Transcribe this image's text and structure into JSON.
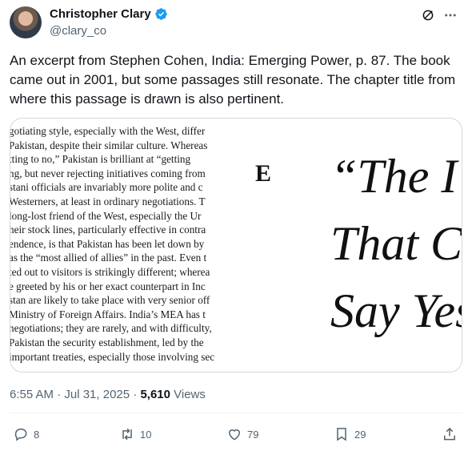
{
  "author": {
    "name": "Christopher Clary",
    "handle": "@clary_co"
  },
  "tweet": {
    "text": "An excerpt from Stephen Cohen, India: Emerging Power, p. 87. The book came out in 2001, but some passages still resonate. The chapter title from where this passage is drawn is also pertinent."
  },
  "image": {
    "left_lines": [
      "gotiating style, especially with the West, differ",
      "Pakistan, despite their similar culture. Whereas",
      "tting to no,” Pakistan is brilliant at “getting",
      "ng, but never rejecting initiatives coming from",
      "stani officials are invariably more polite and c",
      "Westerners, at least in ordinary negotiations. T",
      "long-lost friend of the West, especially the Ur",
      "heir stock lines, particularly effective in contra",
      "endence, is that Pakistan has been let down by",
      "as the “most allied of allies” in the past. Even t",
      "ted out to visitors is strikingly different; wherea",
      "e greeted by his or her exact counterpart in Inc",
      "stan are likely to take place with very senior off",
      "Ministry of Foreign Affairs. India’s MEA has t",
      "negotiations; they are rarely, and with difficulty,",
      "Pakistan the security establishment, led by the",
      "important treaties, especially those involving sec"
    ],
    "right_margin_letter": "E",
    "right_lines": [
      "“The I",
      "That C",
      "Say Yes"
    ]
  },
  "meta": {
    "time_date": "6:55 AM · Jul 31, 2025 · ",
    "views_count": "5,610",
    "views_label": " Views"
  },
  "actions": {
    "replies": "8",
    "reposts": "10",
    "likes": "79",
    "bookmarks": "29"
  },
  "colors": {
    "verified": "#1d9bf0",
    "secondary": "#536471"
  }
}
